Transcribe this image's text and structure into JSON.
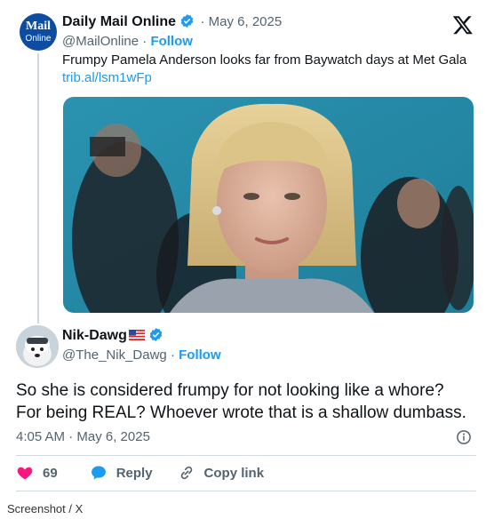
{
  "quoted_tweet": {
    "logo_line1": "Mail",
    "logo_line2": "Online",
    "author_name": "Daily Mail Online",
    "date": "· May 6, 2025",
    "handle": "@MailOnline",
    "follow_label": "Follow",
    "text": "Frumpy Pamela Anderson looks far from Baywatch days at Met Gala",
    "link": "trib.al/lsm1wFp"
  },
  "tweet": {
    "author_name": "Nik-Dawg",
    "handle": "@The_Nik_Dawg",
    "follow_label": "Follow",
    "text": "So she is considered frumpy for not looking like a whore?\nFor being REAL? Whoever wrote that is a shallow dumbass.",
    "timestamp": "4:05 AM · May 6, 2025"
  },
  "actions": {
    "likes": "69",
    "reply_label": "Reply",
    "copy_link_label": "Copy link"
  },
  "caption": "Screenshot / X",
  "colors": {
    "accent": "#1d9bf0",
    "like": "#f91880",
    "mail_blue": "#0c4da2"
  },
  "icons": [
    "x-logo-icon",
    "verified-badge-icon",
    "us-flag-icon",
    "info-icon",
    "heart-icon",
    "reply-icon",
    "link-icon"
  ]
}
